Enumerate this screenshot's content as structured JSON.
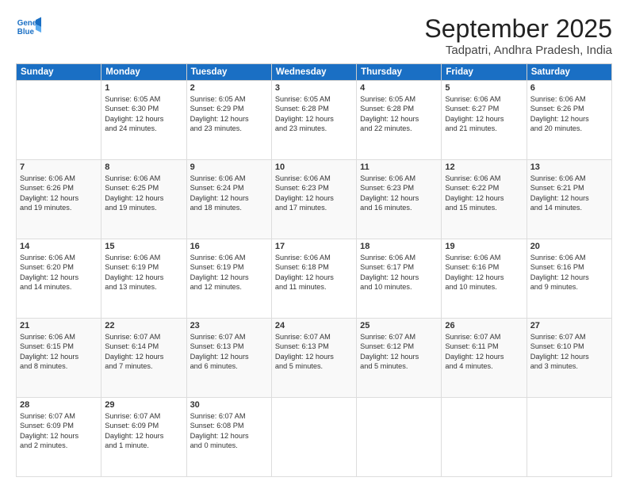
{
  "logo": {
    "line1": "General",
    "line2": "Blue"
  },
  "title": "September 2025",
  "location": "Tadpatri, Andhra Pradesh, India",
  "headers": [
    "Sunday",
    "Monday",
    "Tuesday",
    "Wednesday",
    "Thursday",
    "Friday",
    "Saturday"
  ],
  "weeks": [
    [
      {
        "day": "",
        "info": ""
      },
      {
        "day": "1",
        "info": "Sunrise: 6:05 AM\nSunset: 6:30 PM\nDaylight: 12 hours\nand 24 minutes."
      },
      {
        "day": "2",
        "info": "Sunrise: 6:05 AM\nSunset: 6:29 PM\nDaylight: 12 hours\nand 23 minutes."
      },
      {
        "day": "3",
        "info": "Sunrise: 6:05 AM\nSunset: 6:28 PM\nDaylight: 12 hours\nand 23 minutes."
      },
      {
        "day": "4",
        "info": "Sunrise: 6:05 AM\nSunset: 6:28 PM\nDaylight: 12 hours\nand 22 minutes."
      },
      {
        "day": "5",
        "info": "Sunrise: 6:06 AM\nSunset: 6:27 PM\nDaylight: 12 hours\nand 21 minutes."
      },
      {
        "day": "6",
        "info": "Sunrise: 6:06 AM\nSunset: 6:26 PM\nDaylight: 12 hours\nand 20 minutes."
      }
    ],
    [
      {
        "day": "7",
        "info": "Sunrise: 6:06 AM\nSunset: 6:26 PM\nDaylight: 12 hours\nand 19 minutes."
      },
      {
        "day": "8",
        "info": "Sunrise: 6:06 AM\nSunset: 6:25 PM\nDaylight: 12 hours\nand 19 minutes."
      },
      {
        "day": "9",
        "info": "Sunrise: 6:06 AM\nSunset: 6:24 PM\nDaylight: 12 hours\nand 18 minutes."
      },
      {
        "day": "10",
        "info": "Sunrise: 6:06 AM\nSunset: 6:23 PM\nDaylight: 12 hours\nand 17 minutes."
      },
      {
        "day": "11",
        "info": "Sunrise: 6:06 AM\nSunset: 6:23 PM\nDaylight: 12 hours\nand 16 minutes."
      },
      {
        "day": "12",
        "info": "Sunrise: 6:06 AM\nSunset: 6:22 PM\nDaylight: 12 hours\nand 15 minutes."
      },
      {
        "day": "13",
        "info": "Sunrise: 6:06 AM\nSunset: 6:21 PM\nDaylight: 12 hours\nand 14 minutes."
      }
    ],
    [
      {
        "day": "14",
        "info": "Sunrise: 6:06 AM\nSunset: 6:20 PM\nDaylight: 12 hours\nand 14 minutes."
      },
      {
        "day": "15",
        "info": "Sunrise: 6:06 AM\nSunset: 6:19 PM\nDaylight: 12 hours\nand 13 minutes."
      },
      {
        "day": "16",
        "info": "Sunrise: 6:06 AM\nSunset: 6:19 PM\nDaylight: 12 hours\nand 12 minutes."
      },
      {
        "day": "17",
        "info": "Sunrise: 6:06 AM\nSunset: 6:18 PM\nDaylight: 12 hours\nand 11 minutes."
      },
      {
        "day": "18",
        "info": "Sunrise: 6:06 AM\nSunset: 6:17 PM\nDaylight: 12 hours\nand 10 minutes."
      },
      {
        "day": "19",
        "info": "Sunrise: 6:06 AM\nSunset: 6:16 PM\nDaylight: 12 hours\nand 10 minutes."
      },
      {
        "day": "20",
        "info": "Sunrise: 6:06 AM\nSunset: 6:16 PM\nDaylight: 12 hours\nand 9 minutes."
      }
    ],
    [
      {
        "day": "21",
        "info": "Sunrise: 6:06 AM\nSunset: 6:15 PM\nDaylight: 12 hours\nand 8 minutes."
      },
      {
        "day": "22",
        "info": "Sunrise: 6:07 AM\nSunset: 6:14 PM\nDaylight: 12 hours\nand 7 minutes."
      },
      {
        "day": "23",
        "info": "Sunrise: 6:07 AM\nSunset: 6:13 PM\nDaylight: 12 hours\nand 6 minutes."
      },
      {
        "day": "24",
        "info": "Sunrise: 6:07 AM\nSunset: 6:13 PM\nDaylight: 12 hours\nand 5 minutes."
      },
      {
        "day": "25",
        "info": "Sunrise: 6:07 AM\nSunset: 6:12 PM\nDaylight: 12 hours\nand 5 minutes."
      },
      {
        "day": "26",
        "info": "Sunrise: 6:07 AM\nSunset: 6:11 PM\nDaylight: 12 hours\nand 4 minutes."
      },
      {
        "day": "27",
        "info": "Sunrise: 6:07 AM\nSunset: 6:10 PM\nDaylight: 12 hours\nand 3 minutes."
      }
    ],
    [
      {
        "day": "28",
        "info": "Sunrise: 6:07 AM\nSunset: 6:09 PM\nDaylight: 12 hours\nand 2 minutes."
      },
      {
        "day": "29",
        "info": "Sunrise: 6:07 AM\nSunset: 6:09 PM\nDaylight: 12 hours\nand 1 minute."
      },
      {
        "day": "30",
        "info": "Sunrise: 6:07 AM\nSunset: 6:08 PM\nDaylight: 12 hours\nand 0 minutes."
      },
      {
        "day": "",
        "info": ""
      },
      {
        "day": "",
        "info": ""
      },
      {
        "day": "",
        "info": ""
      },
      {
        "day": "",
        "info": ""
      }
    ]
  ]
}
